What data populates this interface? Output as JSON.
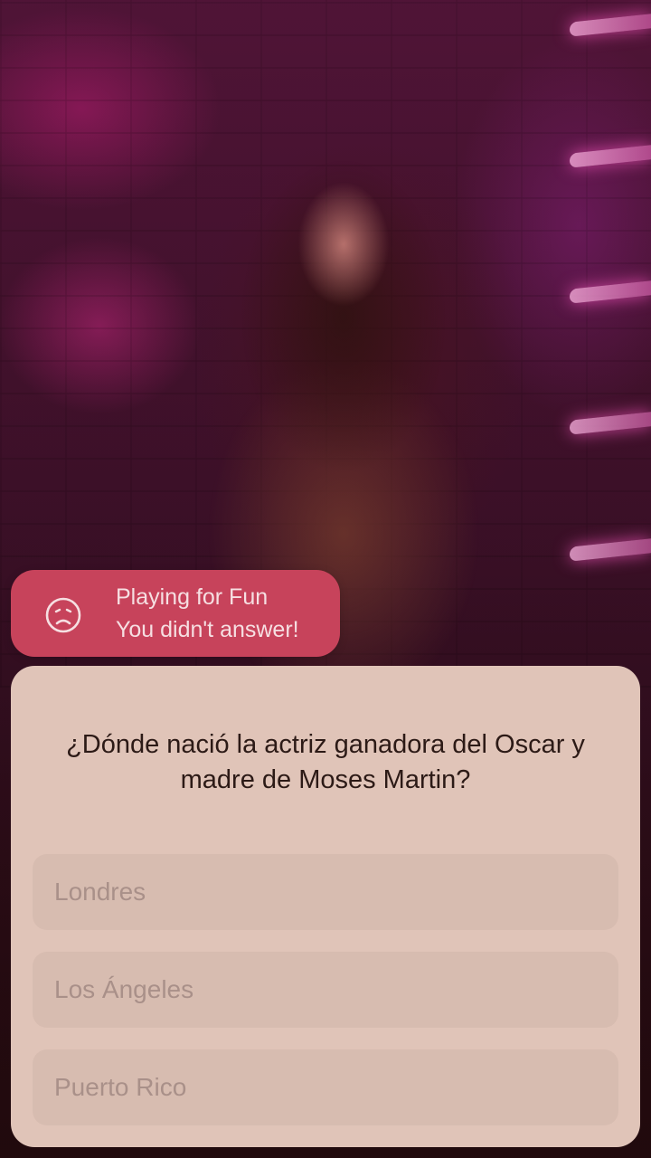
{
  "status": {
    "mode": "Playing for Fun",
    "message": "You didn't answer!",
    "icon": "sad-face-icon",
    "color": "#c7435b"
  },
  "question": {
    "text": "¿Dónde nació la actriz ganadora del Oscar y madre de Moses Martin?"
  },
  "options": [
    {
      "label": "Londres"
    },
    {
      "label": "Los Ángeles"
    },
    {
      "label": "Puerto Rico"
    }
  ],
  "colors": {
    "card": "#e0c4b8",
    "option": "#d7bcb0",
    "question_text": "#2c1a16",
    "option_text": "#a99089"
  }
}
